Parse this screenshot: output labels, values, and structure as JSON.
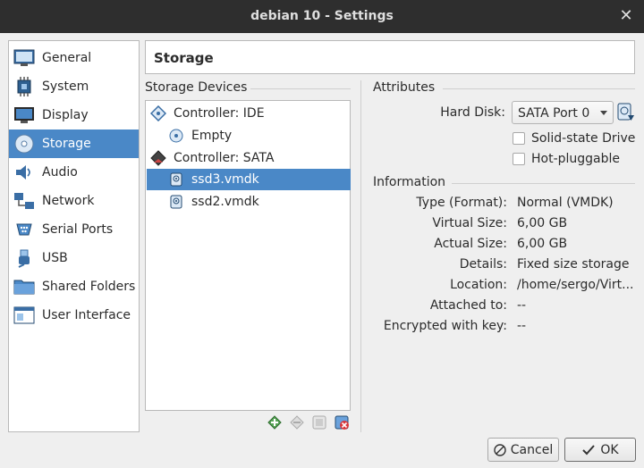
{
  "window": {
    "title": "debian 10 - Settings",
    "close_glyph": "✕"
  },
  "sidebar": {
    "items": [
      {
        "label": "General",
        "icon": "general-icon",
        "selected": false
      },
      {
        "label": "System",
        "icon": "chip-icon",
        "selected": false
      },
      {
        "label": "Display",
        "icon": "monitor-icon",
        "selected": false
      },
      {
        "label": "Storage",
        "icon": "storage-disc-icon",
        "selected": true
      },
      {
        "label": "Audio",
        "icon": "speaker-icon",
        "selected": false
      },
      {
        "label": "Network",
        "icon": "network-icon",
        "selected": false
      },
      {
        "label": "Serial Ports",
        "icon": "serial-port-icon",
        "selected": false
      },
      {
        "label": "USB",
        "icon": "usb-icon",
        "selected": false
      },
      {
        "label": "Shared Folders",
        "icon": "folder-icon",
        "selected": false
      },
      {
        "label": "User Interface",
        "icon": "window-icon",
        "selected": false
      }
    ]
  },
  "header": {
    "title": "Storage"
  },
  "storage_devices": {
    "title": "Storage Devices",
    "rows": [
      {
        "label": "Controller: IDE",
        "icon": "ide-controller-icon",
        "level": 0,
        "selected": false
      },
      {
        "label": "Empty",
        "icon": "optical-disc-icon",
        "level": 1,
        "selected": false
      },
      {
        "label": "Controller: SATA",
        "icon": "sata-controller-icon",
        "level": 0,
        "selected": false
      },
      {
        "label": "ssd3.vmdk",
        "icon": "hard-disk-icon",
        "level": 1,
        "selected": true
      },
      {
        "label": "ssd2.vmdk",
        "icon": "hard-disk-icon",
        "level": 1,
        "selected": false
      }
    ],
    "toolbar": [
      "add-attachment-icon",
      "remove-attachment-icon",
      "add-controller-icon",
      "remove-controller-icon"
    ]
  },
  "attributes": {
    "title": "Attributes",
    "hard_disk_label": "Hard Disk:",
    "hard_disk_value": "SATA Port 0",
    "solid_state_label": "Solid-state Drive",
    "hot_pluggable_label": "Hot-pluggable",
    "solid_state_checked": false,
    "hot_pluggable_checked": false
  },
  "information": {
    "title": "Information",
    "rows": [
      {
        "label": "Type (Format):",
        "value": "Normal (VMDK)"
      },
      {
        "label": "Virtual Size:",
        "value": "6,00 GB"
      },
      {
        "label": "Actual Size:",
        "value": "6,00 GB"
      },
      {
        "label": "Details:",
        "value": "Fixed size storage"
      },
      {
        "label": "Location:",
        "value": "/home/sergo/Virt..."
      },
      {
        "label": "Attached to:",
        "value": "--"
      },
      {
        "label": "Encrypted with key:",
        "value": "--"
      }
    ]
  },
  "buttons": {
    "cancel": "Cancel",
    "ok": "OK"
  }
}
